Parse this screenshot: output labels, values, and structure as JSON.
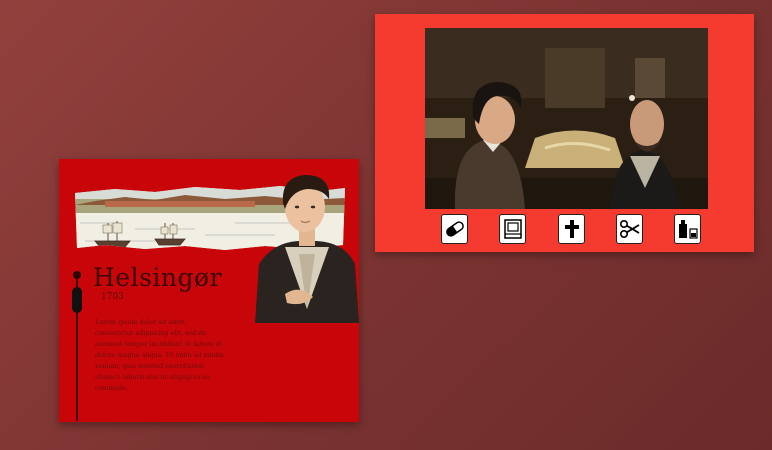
{
  "location": {
    "title": "Helsingør",
    "year": "1703",
    "body": "Lorem ipsum dolor sit amet, consectetur adipiscing elit, sed do eiusmod tempor incididunt ut labore et dolore magna aliqua. Ut enim ad minim veniam, quis nostrud exercitation ullamco laboris nisi ut aliquip ex ea commodo."
  },
  "toolbar": {
    "items": [
      {
        "icon": "pill-icon"
      },
      {
        "icon": "book-icon"
      },
      {
        "icon": "cross-icon"
      },
      {
        "icon": "scissors-icon"
      },
      {
        "icon": "bottles-icon"
      }
    ]
  },
  "colors": {
    "background": "#7a3331",
    "left_card": "#c8060a",
    "right_card": "#f53a2f"
  }
}
